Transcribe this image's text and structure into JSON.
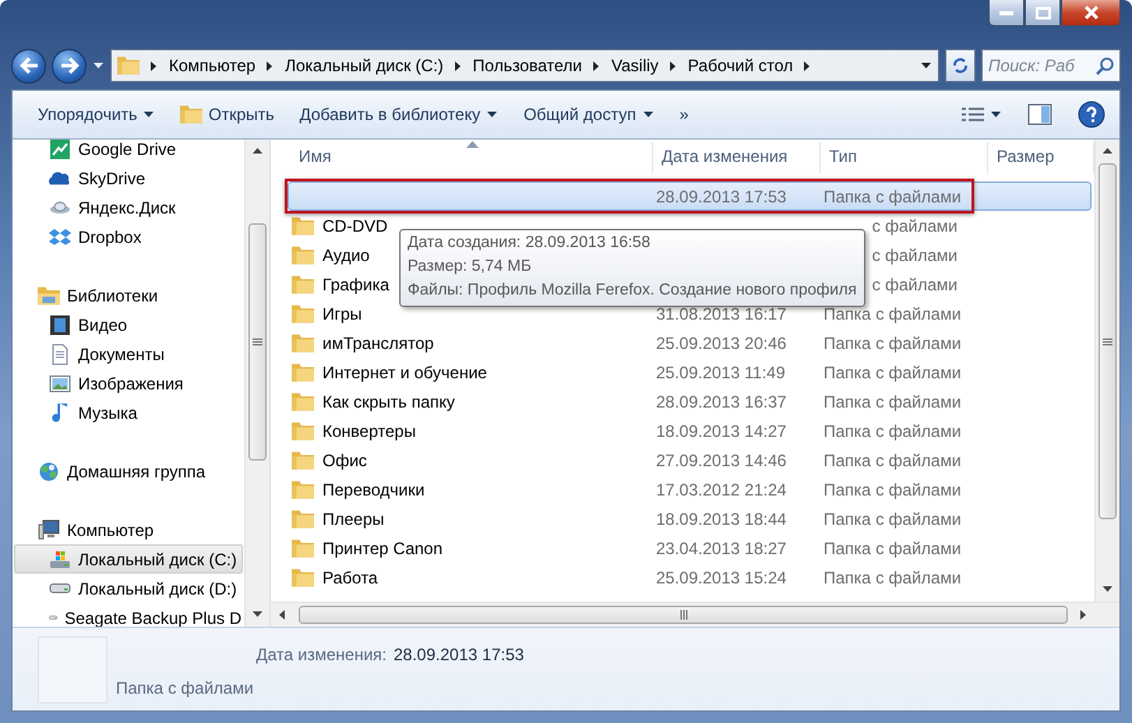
{
  "address_bar": {
    "crumbs": [
      "Компьютер",
      "Локальный диск (C:)",
      "Пользователи",
      "Vasiliy",
      "Рабочий стол"
    ]
  },
  "search": {
    "placeholder": "Поиск: Раб"
  },
  "toolbar": {
    "buttons": [
      {
        "label": "Упорядочить",
        "kind": "menu"
      },
      {
        "label": "Открыть",
        "kind": "open"
      },
      {
        "label": "Добавить в библиотеку",
        "kind": "menu"
      },
      {
        "label": "Общий доступ",
        "kind": "menu"
      },
      {
        "label": "»",
        "kind": "plain"
      }
    ]
  },
  "navigation": [
    {
      "children": [
        {
          "label": "Google Drive",
          "kind": "chart",
          "selected": false
        },
        {
          "label": "SkyDrive",
          "kind": "cloud",
          "selected": false
        },
        {
          "label": "Яндекс.Диск",
          "kind": "dish",
          "selected": false
        },
        {
          "label": "Dropbox",
          "kind": "box",
          "selected": false
        }
      ]
    },
    {
      "label": "Библиотеки",
      "kind": "library",
      "children": [
        {
          "label": "Видео",
          "kind": "video",
          "selected": false
        },
        {
          "label": "Документы",
          "kind": "document",
          "selected": false
        },
        {
          "label": "Изображения",
          "kind": "image",
          "selected": false
        },
        {
          "label": "Музыка",
          "kind": "music",
          "selected": false
        }
      ]
    },
    {
      "label": "Домашняя группа",
      "kind": "network"
    },
    {
      "label": "Компьютер",
      "kind": "computer",
      "children": [
        {
          "label": "Локальный диск (C:)",
          "kind": "system-drive",
          "selected": true
        },
        {
          "label": "Локальный диск (D:)",
          "kind": "drive",
          "selected": false
        },
        {
          "label": "Seagate Backup Plus D",
          "kind": "drive",
          "selected": false
        }
      ]
    }
  ],
  "table": {
    "columns": [
      {
        "label": "Имя",
        "sorted": true
      },
      {
        "label": "Дата изменения",
        "sorted": false
      },
      {
        "label": "Тип",
        "sorted": false
      },
      {
        "label": "Размер",
        "sorted": false
      }
    ],
    "rows": [
      {
        "date": "28.09.2013 17:53",
        "type": "Папка с файлами",
        "selected": true,
        "outlined": true
      },
      {
        "name": "CD-DVD",
        "type": "с файлами",
        "selected": false,
        "outlined": false
      },
      {
        "name": "Аудио",
        "type": "с файлами",
        "selected": false,
        "outlined": false
      },
      {
        "name": "Графика",
        "type": "с файлами",
        "selected": false,
        "outlined": false
      },
      {
        "name": "Игры",
        "date": "31.08.2013 16:17",
        "type": "Папка с файлами",
        "selected": false,
        "outlined": false
      },
      {
        "name": "имТранслятор",
        "date": "25.09.2013 20:46",
        "type": "Папка с файлами",
        "selected": false,
        "outlined": false
      },
      {
        "name": "Интернет и обучение",
        "date": "25.09.2013 11:49",
        "type": "Папка с файлами",
        "selected": false,
        "outlined": false
      },
      {
        "name": "Как скрыть папку",
        "date": "28.09.2013 16:37",
        "type": "Папка с файлами",
        "selected": false,
        "outlined": false
      },
      {
        "name": "Конвертеры",
        "date": "18.09.2013 14:27",
        "type": "Папка с файлами",
        "selected": false,
        "outlined": false
      },
      {
        "name": "Офис",
        "date": "27.09.2013 14:46",
        "type": "Папка с файлами",
        "selected": false,
        "outlined": false
      },
      {
        "name": "Переводчики",
        "date": "17.03.2012 21:24",
        "type": "Папка с файлами",
        "selected": false,
        "outlined": false
      },
      {
        "name": "Плееры",
        "date": "18.09.2013 18:44",
        "type": "Папка с файлами",
        "selected": false,
        "outlined": false
      },
      {
        "name": "Принтер Canon",
        "date": "23.04.2013 18:27",
        "type": "Папка с файлами",
        "selected": false,
        "outlined": false
      },
      {
        "name": "Работа",
        "date": "25.09.2013 15:24",
        "type": "Папка с файлами",
        "selected": false,
        "outlined": false
      }
    ]
  },
  "tooltip": {
    "lines": [
      "Дата создания: 28.09.2013 16:58",
      "Размер: 5,74 МБ",
      "Файлы: Профиль Mozilla Ferefox. Создание нового профиля"
    ]
  },
  "details": {
    "date_label": "Дата изменения:",
    "date_value": "28.09.2013 17:53",
    "type": "Папка с файлами"
  }
}
